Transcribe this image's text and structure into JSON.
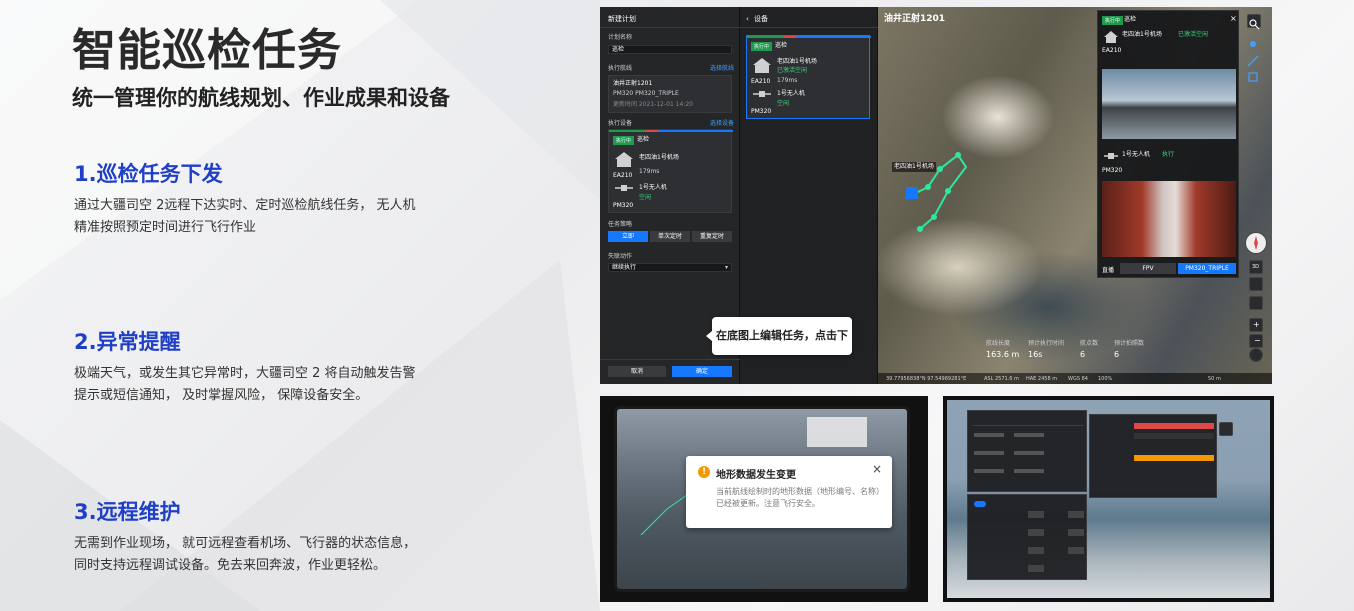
{
  "hero": {
    "title": "智能巡检任务",
    "subtitle": "统一管理你的航线规划、作业成果和设备"
  },
  "sections": [
    {
      "title": "1.巡检任务下发",
      "lines": [
        "通过大疆司空 2远程下达实时、定时巡检航线任务， 无人机",
        "精准按照预定时间进行飞行作业"
      ]
    },
    {
      "title": "2.异常提醒",
      "lines": [
        "极端天气，或发生其它异常时，大疆司空 2 将自动触发告警",
        "提示或短信通知， 及时掌握风险， 保障设备安全。"
      ]
    },
    {
      "title": "3.远程维护",
      "lines": [
        "无需到作业现场， 就可远程查看机场、飞行器的状态信息，",
        "同时支持远程调试设备。免去来回奔波，作业更轻松。"
      ]
    }
  ],
  "plan_panel": {
    "header": "新建计划",
    "plan_name_label": "计划名称",
    "plan_name_value": "巡检",
    "route_label": "执行航线",
    "route_action": "选择航线",
    "route_name": "油井正射1201",
    "route_models": "PM320  PM320_TRIPLE",
    "route_updated": "更新时间 2021-12-01 14:20",
    "device_label": "执行设备",
    "device_action": "选择设备",
    "device_status": "执行中",
    "device_name": "巡检",
    "dock_name": "老四油1号机场",
    "dock_model": "EA210",
    "dock_signal": "179ms",
    "drone_name": "1号无人机",
    "drone_model": "PM320",
    "drone_state": "空闲",
    "type_label": "任务策略",
    "types": [
      "立即",
      "单次定时",
      "重复定时"
    ],
    "cond_label": "失联动作",
    "cond_value": "继续执行",
    "cancel": "取消",
    "confirm": "确定"
  },
  "device_panel": {
    "header": "设备",
    "card_status": "执行中",
    "card_name": "巡检",
    "dock_name": "老四油1号机场",
    "dock_state": "已激活空闲",
    "dock_model": "EA210",
    "dock_signal": "179ms",
    "drone_name": "1号无人机",
    "drone_model": "PM320",
    "drone_state": "空闲"
  },
  "map_view": {
    "title": "油井正射1201",
    "stats_labels": [
      "航线长度",
      "预计执行时间",
      "航点数",
      "预计拍照数"
    ],
    "stats_values": [
      "163.6 m",
      "16s",
      "6",
      "6"
    ],
    "coords": "39.77956838°N  97.54989281°E",
    "footer_items": [
      "ASL 2571.6 m",
      "HAE 2458 m",
      "WGS 84",
      "100%"
    ],
    "scale": "50 m",
    "map_label": "老四油1号机场"
  },
  "float_panel": {
    "status": "执行中",
    "title": "巡检",
    "dock_name": "老四油1号机场",
    "dock_model": "EA210",
    "dock_state": "已激活空闲",
    "drone_name": "1号无人机",
    "drone_model": "PM320",
    "drone_state": "执行",
    "tab_left": "FPV",
    "tab_right": "PM320_TRIPLE",
    "tab_label": "直播"
  },
  "callout": "在底图上编辑任务，点击下发",
  "alert": {
    "title": "地形数据发生变更",
    "body": "当前航线绘制时的地形数据（地形编号、名称）已经被更新。注意飞行安全。",
    "close": "×"
  },
  "colors": {
    "accent_blue": "#1f3fc6",
    "ui_blue": "#1677ff",
    "ui_green": "#1f9a4f",
    "warning": "#f39800"
  }
}
